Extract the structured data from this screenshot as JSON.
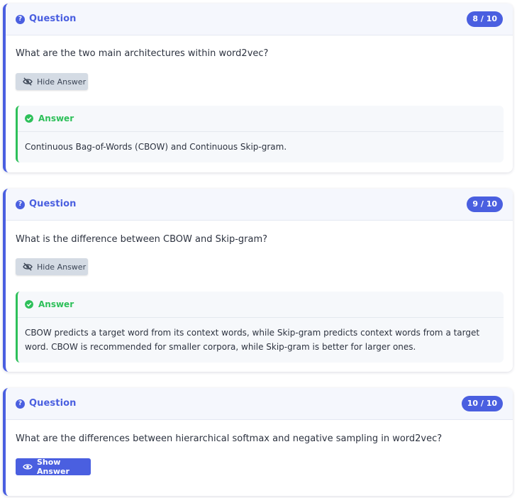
{
  "cards": [
    {
      "header_title": "Question",
      "badge": "8 / 10",
      "question": "What are the two main architectures within word2vec?",
      "button_label": "Hide Answer",
      "answer_title": "Answer",
      "answer_text": "Continuous Bag-of-Words (CBOW) and Continuous Skip-gram."
    },
    {
      "header_title": "Question",
      "badge": "9 / 10",
      "question": "What is the difference between CBOW and Skip-gram?",
      "button_label": "Hide Answer",
      "answer_title": "Answer",
      "answer_text_line1": "CBOW predicts a target word from its context words, while Skip-gram predicts context words from a target",
      "answer_text_line2": "word. CBOW is recommended for smaller corpora, while Skip-gram is better for larger ones."
    },
    {
      "header_title": "Question",
      "badge": "10 / 10",
      "question": "What are the differences between hierarchical softmax and negative sampling in word2vec?",
      "button_label": "Show Answer"
    }
  ],
  "colors": {
    "accent": "#4a5fe0",
    "success": "#2ec05a",
    "header_bg": "#f5f7fd",
    "hide_button_bg": "#d4dbe4"
  },
  "icons": {
    "question": "question-circle-icon",
    "answer": "check-circle-icon",
    "hide": "eye-slash-icon",
    "show": "eye-icon"
  }
}
